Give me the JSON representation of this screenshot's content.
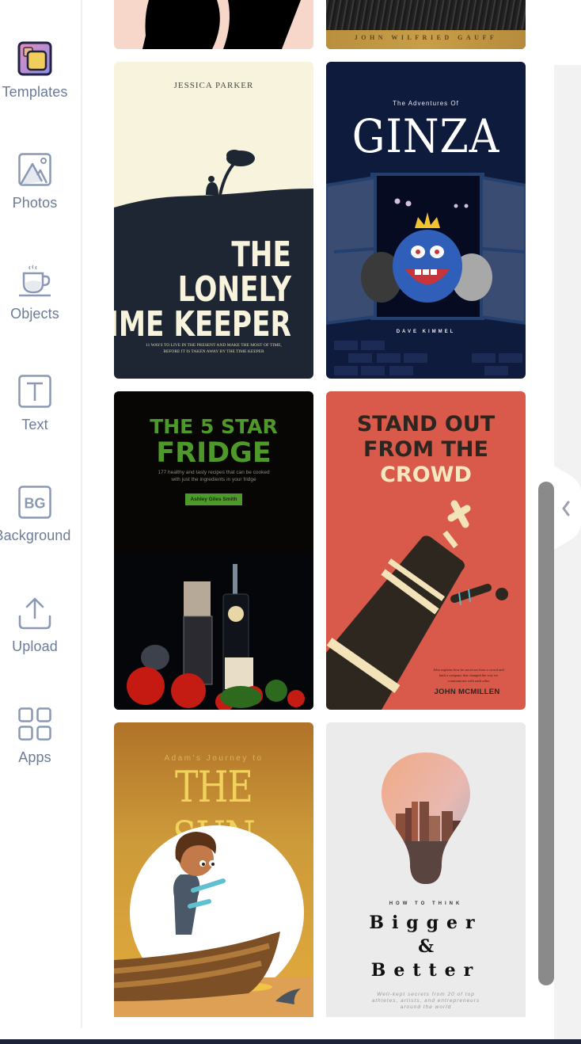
{
  "sidebar": {
    "items": [
      {
        "label": "Templates",
        "icon": "templates-icon",
        "active": true
      },
      {
        "label": "Photos",
        "icon": "photos-icon"
      },
      {
        "label": "Objects",
        "icon": "objects-icon"
      },
      {
        "label": "Text",
        "icon": "text-icon"
      },
      {
        "label": "Background",
        "icon": "background-icon",
        "icon_text": "BG"
      },
      {
        "label": "Upload",
        "icon": "upload-icon"
      },
      {
        "label": "Apps",
        "icon": "apps-icon"
      }
    ]
  },
  "templates": [
    {
      "author": "",
      "title": "",
      "note": "partially visible silhouette cover"
    },
    {
      "author": "JOHN WILFRIED GAUFF"
    },
    {
      "author": "JESSICA PARKER",
      "title_lines": [
        "THE",
        "LONELY",
        "TIME KEEPER"
      ],
      "subtitle_lines": [
        "11 WAYS TO LIVE IN THE PRESENT AND MAKE THE MOST OF TIME,",
        "BEFORE IT IS TAKEN AWAY BY THE TIME KEEPER"
      ]
    },
    {
      "kicker": "The Adventures Of",
      "title": "GINZA",
      "author": "DAVE KIMMEL"
    },
    {
      "title_lines": [
        "THE 5 STAR",
        "FRIDGE"
      ],
      "subtitle_lines": [
        "177 healthy and tasty recipes that can be cooked",
        "with just the ingredients in your fridge"
      ],
      "author": "Ashley Giles Smith"
    },
    {
      "title_lines": [
        "STAND OUT",
        "FROM THE",
        "CROWD"
      ],
      "subtitle_lines": [
        "John explains how he stood out from a crowd and",
        "built a company that changed the way we",
        "communicate with each other"
      ],
      "author": "JOHN MCMILLEN"
    },
    {
      "kicker": "Adam's Journey to",
      "title": "THE SUN"
    },
    {
      "kicker": "HOW TO THINK",
      "title_lines": [
        "Bigger",
        "&",
        "Better"
      ],
      "subtitle_lines": [
        "Well-kept secrets from 20 of top",
        "athletes, artists, and entrepreneurs",
        "around the world"
      ]
    }
  ],
  "colors": {
    "sidebar_text": "#6d7b98",
    "scroll_thumb": "#8a8a8a",
    "active_icon_fill": "#f0cd5c"
  }
}
